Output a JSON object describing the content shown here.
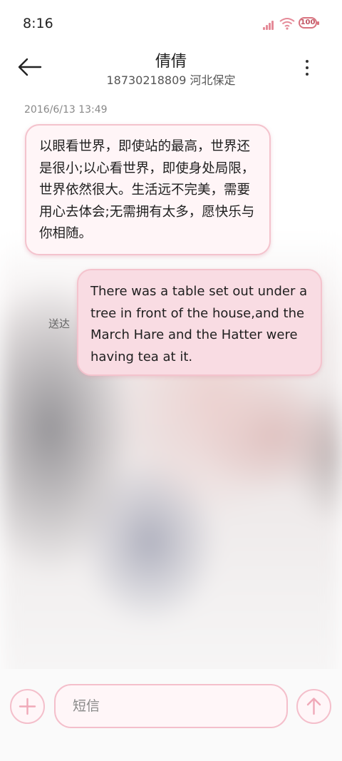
{
  "status_bar": {
    "time": "8:16",
    "battery": "100",
    "icons": [
      "signal-icon",
      "wifi-icon",
      "battery-icon"
    ]
  },
  "header": {
    "contact_name": "倩倩",
    "contact_info": "18730218809 河北保定",
    "back_icon": "arrow-left-icon",
    "menu_icon": "more-vertical-icon"
  },
  "conversation": {
    "timestamp": "2016/6/13 13:49",
    "messages": [
      {
        "direction": "incoming",
        "text": "以眼看世界，即使站的最高，世界还是很小;以心看世界，即使身处局限，世界依然很大。生活远不完美，需要用心去体会;无需拥有太多，愿快乐与你相随。"
      },
      {
        "direction": "outgoing",
        "status": "送达",
        "text": "There was a table set out under a tree in front of the house,and the March Hare and the Hatter were having tea at it."
      }
    ]
  },
  "compose": {
    "placeholder": "短信",
    "add_icon": "plus-icon",
    "send_icon": "arrow-up-icon"
  },
  "colors": {
    "accent": "#f4c3cd",
    "incoming_bubble": "#fff5f7",
    "outgoing_bubble": "#f9dce3",
    "icon_pink": "#f0a9b8"
  }
}
